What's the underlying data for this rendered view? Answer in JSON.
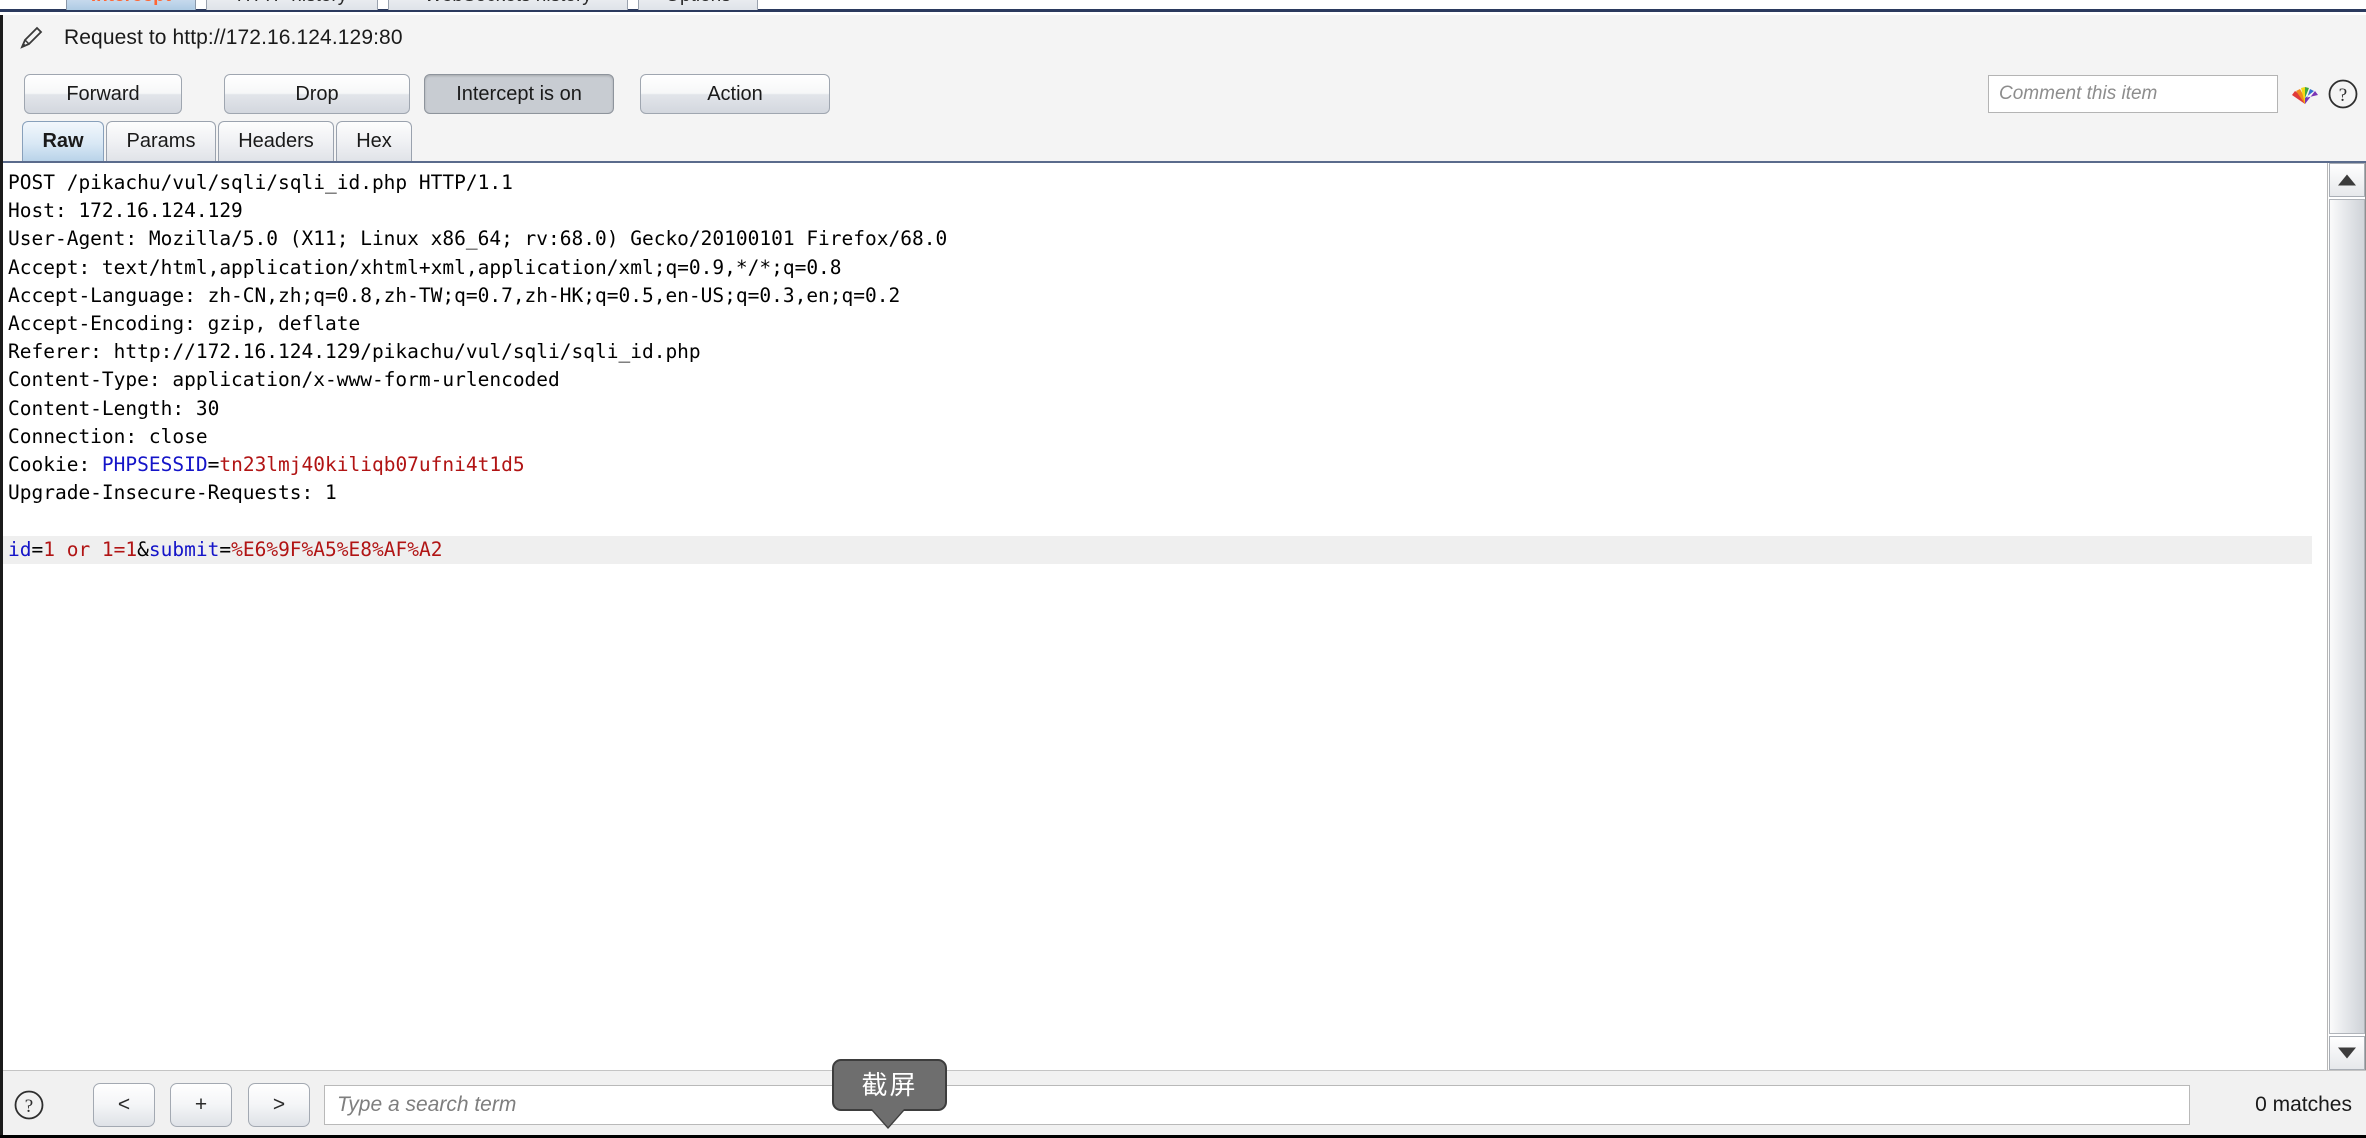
{
  "main_tabs": [
    {
      "label": "Intercept",
      "active": true
    },
    {
      "label": "HTTP history",
      "active": false
    },
    {
      "label": "WebSockets history",
      "active": false
    },
    {
      "label": "Options",
      "active": false
    }
  ],
  "request_bar": {
    "pencil_icon": "pencil-icon",
    "title": "Request to http://172.16.124.129:80"
  },
  "toolbar": {
    "forward_label": "Forward",
    "drop_label": "Drop",
    "intercept_label": "Intercept is on",
    "action_label": "Action",
    "comment_placeholder": "Comment this item",
    "comment_value": "",
    "rainbow_icon": "rainbow-highlight-icon",
    "help_icon": "help-icon"
  },
  "sub_tabs": [
    {
      "label": "Raw",
      "active": true
    },
    {
      "label": "Params",
      "active": false
    },
    {
      "label": "Headers",
      "active": false
    },
    {
      "label": "Hex",
      "active": false
    }
  ],
  "request": {
    "request_line": "POST /pikachu/vul/sqli/sqli_id.php HTTP/1.1",
    "headers": [
      "Host: 172.16.124.129",
      "User-Agent: Mozilla/5.0 (X11; Linux x86_64; rv:68.0) Gecko/20100101 Firefox/68.0",
      "Accept: text/html,application/xhtml+xml,application/xml;q=0.9,*/*;q=0.8",
      "Accept-Language: zh-CN,zh;q=0.8,zh-TW;q=0.7,zh-HK;q=0.5,en-US;q=0.3,en;q=0.2",
      "Accept-Encoding: gzip, deflate",
      "Referer: http://172.16.124.129/pikachu/vul/sqli/sqli_id.php",
      "Content-Type: application/x-www-form-urlencoded",
      "Content-Length: 30",
      "Connection: close"
    ],
    "cookie_label": "Cookie: ",
    "cookie_name": "PHPSESSID",
    "cookie_eq": "=",
    "cookie_value": "tn23lmj40kiliqb07ufni4t1d5",
    "trailing_header": "Upgrade-Insecure-Requests: 1",
    "body": {
      "p1_name": "id",
      "p1_eq": "=",
      "p1_value": "1 or 1=1",
      "amp": "&",
      "p2_name": "submit",
      "p2_eq": "=",
      "p2_value": "%E6%9F%A5%E8%AF%A2"
    }
  },
  "scrollbar": {
    "up_icon": "scroll-up-arrow-icon",
    "down_icon": "scroll-down-arrow-icon"
  },
  "bottom_bar": {
    "help_icon": "help-icon",
    "prev_label": "<",
    "add_label": "+",
    "next_label": ">",
    "search_placeholder": "Type a search term",
    "search_value": "",
    "match_count": "0 matches"
  },
  "overlay": {
    "tooltip_text": "截屏"
  },
  "colors": {
    "accent_tab": "#ff6633",
    "header_name": "#1414c8",
    "header_value": "#b11414",
    "toolbar_bg": "#f4f4f4",
    "body_highlight": "#efefef"
  }
}
